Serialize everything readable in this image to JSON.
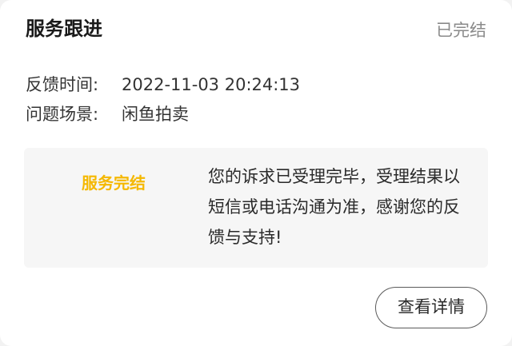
{
  "card": {
    "title": "服务跟进",
    "status": "已完结"
  },
  "info": {
    "time_label": "反馈时间:",
    "time_value": "2022-11-03 20:24:13",
    "scene_label": "问题场景:",
    "scene_value": "闲鱼拍卖"
  },
  "panel": {
    "tag": "服务完结",
    "message": "您的诉求已受理完毕，受理结果以短信或电话沟通为准，感谢您的反馈与支持!"
  },
  "actions": {
    "detail_label": "查看详情"
  },
  "colors": {
    "accent": "#f5b800",
    "status_gray": "#8a8a8a"
  }
}
